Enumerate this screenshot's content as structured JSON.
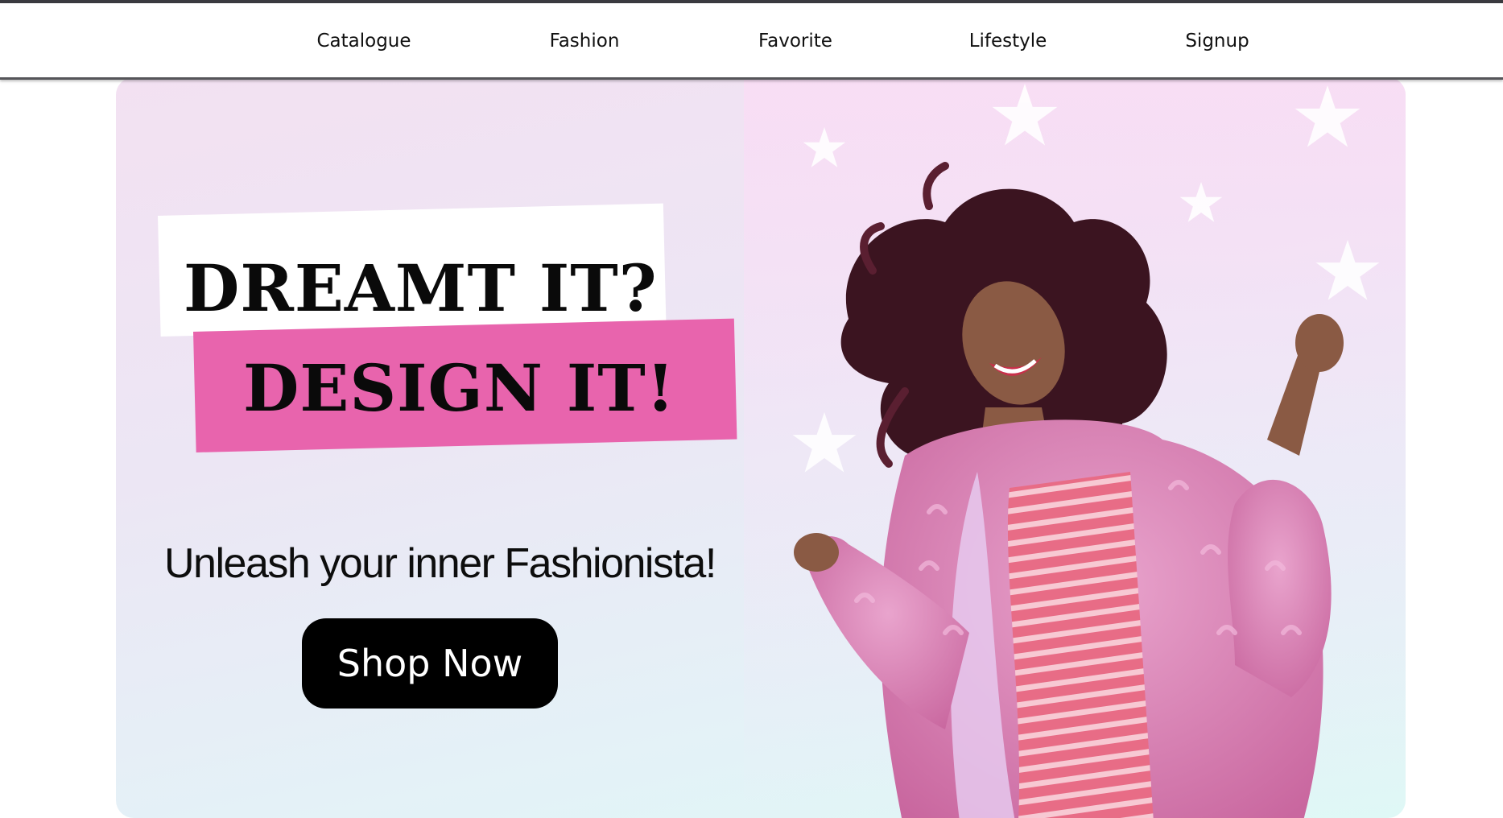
{
  "nav": {
    "items": [
      {
        "label": "Catalogue"
      },
      {
        "label": "Fashion"
      },
      {
        "label": "Favorite"
      },
      {
        "label": "Lifestyle"
      },
      {
        "label": "Signup"
      }
    ]
  },
  "hero": {
    "headline_line1": "DREAMT IT?",
    "headline_line2": "DESIGN IT!",
    "tagline": "Unleash your inner Fashionista!",
    "cta_label": "Shop Now",
    "accent_color": "#e864ad",
    "background_gradient": [
      "#f3e1f2",
      "#dff8f6"
    ],
    "image_subject": "woman in pink fluffy coat with curly hair, dancing"
  },
  "icons": {
    "decorative": "star-icon"
  }
}
